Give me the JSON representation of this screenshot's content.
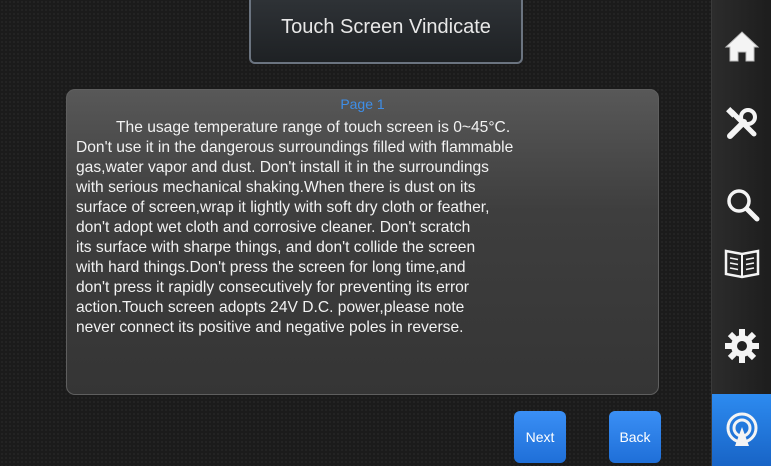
{
  "header": {
    "title": "Touch Screen Vindicate"
  },
  "content": {
    "page_label": "Page 1",
    "lines": [
      "The usage temperature range of touch screen is 0~45°C.",
      "Don't use it in the dangerous surroundings filled with flammable",
      "gas,water vapor and dust. Don't install it in the surroundings",
      "with serious mechanical shaking.When there is dust on its",
      "surface of screen,wrap it lightly with soft dry cloth or feather,",
      "don't adopt wet cloth and corrosive cleaner. Don't scratch",
      "its surface with sharpe things, and don't collide the screen",
      "with hard things.Don't press the screen for long time,and",
      "don't press it rapidly consecutively for preventing its error",
      "action.Touch screen adopts 24V D.C. power,please note",
      "never connect its positive and negative poles in reverse."
    ]
  },
  "buttons": {
    "next": "Next",
    "back": "Back"
  },
  "sidebar": {
    "items": [
      {
        "icon": "home-icon"
      },
      {
        "icon": "tools-icon"
      },
      {
        "icon": "search-icon"
      },
      {
        "icon": "book-icon"
      },
      {
        "icon": "gear-icon"
      },
      {
        "icon": "touch-screen-icon",
        "active": true
      }
    ]
  },
  "colors": {
    "accent": "#2a7fe6",
    "page_label": "#3e8ee8"
  }
}
